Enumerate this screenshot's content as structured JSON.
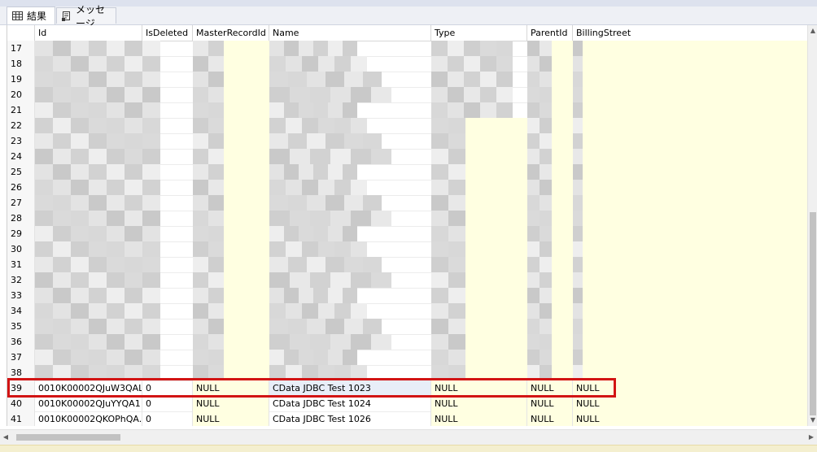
{
  "tabs": [
    {
      "label": "結果",
      "icon": "grid-icon",
      "active": true
    },
    {
      "label": "メッセージ",
      "icon": "message-icon",
      "active": false
    }
  ],
  "columns": [
    "Id",
    "IsDeleted",
    "MasterRecordId",
    "Name",
    "Type",
    "ParentId",
    "BillingStreet"
  ],
  "redacted_row_numbers": [
    "17",
    "18",
    "19",
    "20",
    "21",
    "22",
    "23",
    "24",
    "25",
    "26",
    "27",
    "28",
    "29",
    "30",
    "31",
    "32",
    "33",
    "34",
    "35",
    "36",
    "37",
    "38"
  ],
  "rows": [
    {
      "n": "39",
      "id": "0010K00002QJuW3QAL",
      "isdeleted": "0",
      "master": "NULL",
      "name": "CData JDBC Test 1023",
      "type": "NULL",
      "parent": "NULL",
      "billing": "NULL"
    },
    {
      "n": "40",
      "id": "0010K00002QJuYYQA1",
      "isdeleted": "0",
      "master": "NULL",
      "name": "CData JDBC Test 1024",
      "type": "NULL",
      "parent": "NULL",
      "billing": "NULL"
    },
    {
      "n": "41",
      "id": "0010K00002QKOPhQA...",
      "isdeleted": "0",
      "master": "NULL",
      "name": "CData JDBC Test 1026",
      "type": "NULL",
      "parent": "NULL",
      "billing": "NULL"
    }
  ],
  "highlighted_row": "39",
  "colors": {
    "highlight": "#d21414",
    "null_bg": "#ffffe1",
    "selected_cell": "#e8eef8"
  }
}
